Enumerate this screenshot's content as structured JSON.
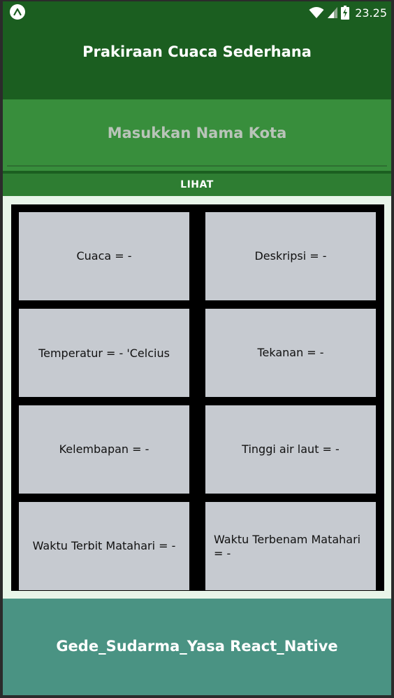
{
  "status_bar": {
    "time": "23.25",
    "icons": [
      "app-notification-icon",
      "wifi-icon",
      "signal-icon",
      "battery-charging-icon"
    ]
  },
  "header": {
    "title": "Prakiraan Cuaca Sederhana"
  },
  "search": {
    "placeholder": "Masukkan Nama Kota",
    "value": ""
  },
  "actions": {
    "view_label": "LIHAT"
  },
  "weather": {
    "cuaca": "Cuaca = -",
    "deskripsi": "Deskripsi = -",
    "temperatur": "Temperatur = - 'Celcius",
    "tekanan": "Tekanan = -",
    "kelembapan": "Kelembapan = -",
    "tinggi_air_laut": "Tinggi air laut = -",
    "waktu_terbit": "Waktu Terbit Matahari = -",
    "waktu_terbenam": "Waktu Terbenam Matahari = -"
  },
  "footer": {
    "text": "Gede_Sudarma_Yasa React_Native"
  },
  "colors": {
    "header_bg": "#1b5e20",
    "input_bg": "#388e3c",
    "button_bg": "#2e7d32",
    "content_bg": "#e8f5e9",
    "cell_bg": "#c6cad0",
    "footer_bg": "#4a9383"
  }
}
